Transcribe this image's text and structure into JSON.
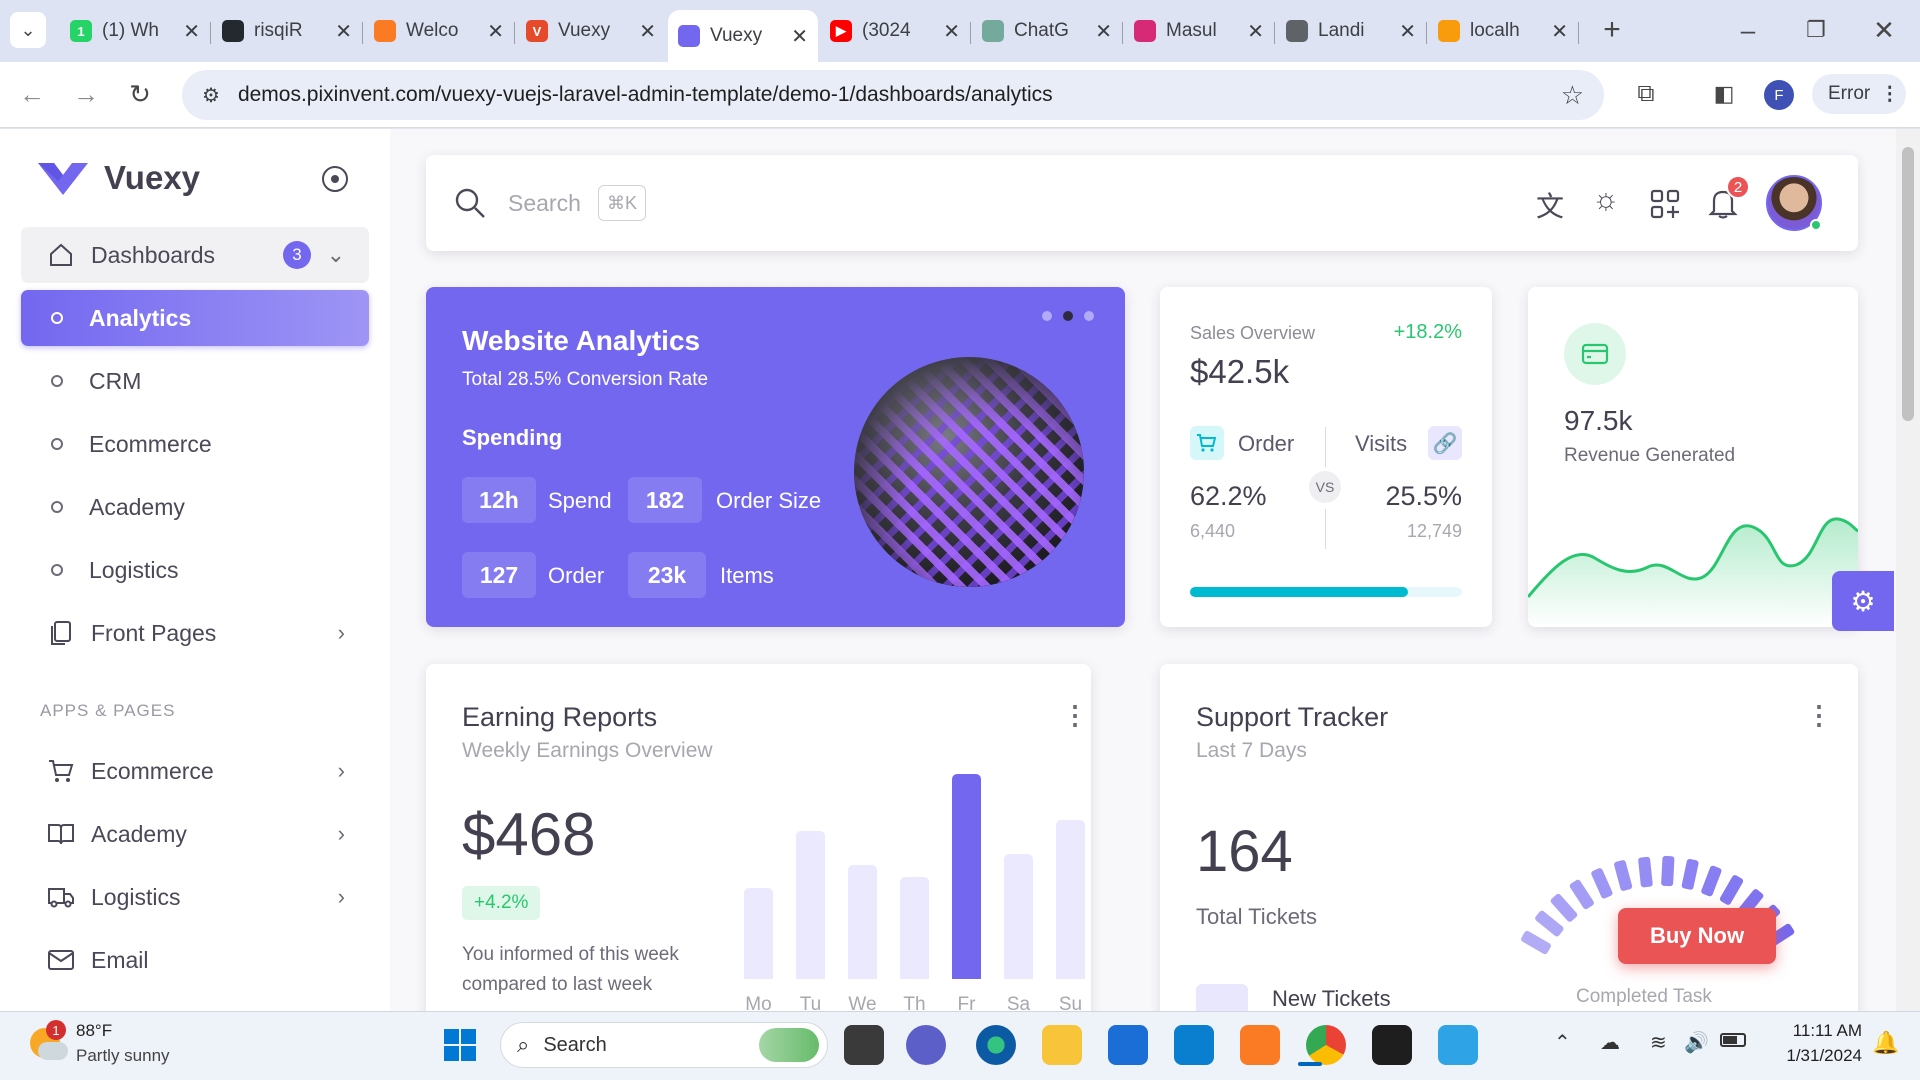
{
  "browser": {
    "tabs": [
      {
        "title": "(1) Wh",
        "icon": "whatsapp-icon",
        "color": "#25d366",
        "glyph": "1"
      },
      {
        "title": "risqiR",
        "icon": "github-icon",
        "color": "#24292f",
        "glyph": ""
      },
      {
        "title": "Welco",
        "icon": "xampp-icon",
        "color": "#fb7a24",
        "glyph": ""
      },
      {
        "title": "Vuexy",
        "icon": "vuejs-icon",
        "color": "#e54b2a",
        "glyph": "V"
      },
      {
        "title": "Vuexy",
        "icon": "vuexy-icon",
        "color": "#7367f0",
        "glyph": ""
      },
      {
        "title": "(3024",
        "icon": "youtube-icon",
        "color": "#ff0000",
        "glyph": "▶"
      },
      {
        "title": "ChatG",
        "icon": "chatgpt-icon",
        "color": "#74aa9c",
        "glyph": ""
      },
      {
        "title": "Masul",
        "icon": "instagram-icon",
        "color": "#d62976",
        "glyph": ""
      },
      {
        "title": "Landi",
        "icon": "globe-icon",
        "color": "#5f6368",
        "glyph": ""
      },
      {
        "title": "localh",
        "icon": "phpmyadmin-icon",
        "color": "#f89c0e",
        "glyph": ""
      }
    ],
    "url": "demos.pixinvent.com/vuexy-vuejs-laravel-admin-template/demo-1/dashboards/analytics",
    "profile_initial": "F",
    "error_label": "Error"
  },
  "sidebar": {
    "brand": "Vuexy",
    "dashboards": {
      "label": "Dashboards",
      "badge": "3"
    },
    "sub_items": [
      "Analytics",
      "CRM",
      "Ecommerce",
      "Academy",
      "Logistics"
    ],
    "front_pages": "Front Pages",
    "section": "APPS & PAGES",
    "apps": [
      {
        "label": "Ecommerce",
        "icon": "cart-icon"
      },
      {
        "label": "Academy",
        "icon": "book-icon"
      },
      {
        "label": "Logistics",
        "icon": "truck-icon"
      },
      {
        "label": "Email",
        "icon": "mail-icon"
      }
    ]
  },
  "topbar": {
    "search_placeholder": "Search",
    "shortcut": "⌘K",
    "notifications": "2"
  },
  "analytics_card": {
    "title": "Website Analytics",
    "subtitle": "Total 28.5% Conversion Rate",
    "section": "Spending",
    "stats": [
      {
        "value": "12h",
        "label": "Spend"
      },
      {
        "value": "182",
        "label": "Order Size"
      },
      {
        "value": "127",
        "label": "Order"
      },
      {
        "value": "23k",
        "label": "Items"
      }
    ]
  },
  "sales_card": {
    "title": "Sales Overview",
    "change": "+18.2%",
    "amount": "$42.5k",
    "order_label": "Order",
    "visits_label": "Visits",
    "vs": "VS",
    "order_pct": "62.2%",
    "order_count": "6,440",
    "visits_pct": "25.5%",
    "visits_count": "12,749",
    "progress": 0.8
  },
  "revenue_card": {
    "value": "97.5k",
    "label": "Revenue Generated"
  },
  "earning_card": {
    "title": "Earning Reports",
    "subtitle": "Weekly Earnings Overview",
    "amount": "$468",
    "change": "+4.2%",
    "note_line1": "You informed of this week",
    "note_line2": "compared to last week"
  },
  "chart_data": {
    "type": "bar",
    "categories": [
      "Mo",
      "Tu",
      "We",
      "Th",
      "Fr",
      "Sa",
      "Su"
    ],
    "values": [
      40,
      65,
      50,
      45,
      90,
      55,
      70
    ],
    "highlight": "Fr"
  },
  "support_card": {
    "title": "Support Tracker",
    "subtitle": "Last 7 Days",
    "total": "164",
    "total_label": "Total Tickets",
    "new_tickets": "New Tickets",
    "completed": "Completed Task",
    "buy_now": "Buy Now"
  },
  "taskbar": {
    "temp": "88°F",
    "weather": "Partly sunny",
    "weather_badge": "1",
    "search": "Search",
    "time": "11:11 AM",
    "date": "1/31/2024"
  },
  "colors": {
    "primary": "#7367f0",
    "success": "#28c76f",
    "info": "#00bad1",
    "danger": "#ea5455"
  }
}
